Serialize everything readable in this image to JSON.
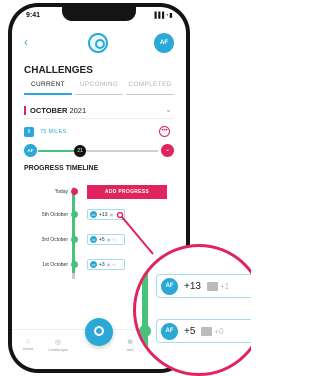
{
  "status_bar": {
    "time": "9:41",
    "signal": "▐▐▐ ◔ ▮"
  },
  "header": {
    "back_icon": "‹",
    "avatar": "AF"
  },
  "page_title": "CHALLENGES",
  "tabs": [
    {
      "label": "CURRENT",
      "active": true
    },
    {
      "label": "UPCOMING",
      "active": false
    },
    {
      "label": "COMPLETED",
      "active": false
    }
  ],
  "month": {
    "label_bold": "OCTOBER",
    "label_year": "2021",
    "chevron": "⌄"
  },
  "goal": {
    "badge": "6",
    "label": "75 MILES",
    "more_icon": "•••"
  },
  "progress": {
    "avatar": "AF",
    "value": "21",
    "fraction": 0.35,
    "down_icon": "⌄"
  },
  "timeline": {
    "title": "PROGRESS TIMELINE",
    "today_label": "Today",
    "add_button": "ADD PROGRESS",
    "entries": [
      {
        "date": "5th October",
        "avatar": "AF",
        "value": "+13",
        "photos": "+1"
      },
      {
        "date": "3rd October",
        "avatar": "AF",
        "value": "+5",
        "photos": "+0"
      },
      {
        "date": "1st October",
        "avatar": "AF",
        "value": "+3",
        "photos": "+0"
      }
    ]
  },
  "navbar": {
    "left": "Home",
    "left2": "Challenges",
    "right": "Add"
  },
  "magnified": [
    {
      "avatar": "AF",
      "value": "+13",
      "photos": "+1"
    },
    {
      "avatar": "AF",
      "value": "+5",
      "photos": "+0"
    }
  ],
  "colors": {
    "accent": "#2aa9d6",
    "danger": "#e0245e",
    "success": "#47c27a"
  }
}
